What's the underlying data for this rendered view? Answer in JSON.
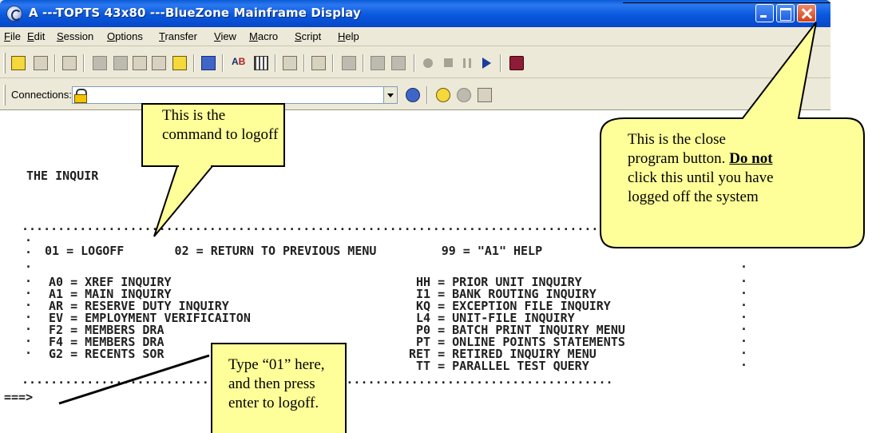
{
  "window": {
    "title": "A ---TOPTS 43x80 ---BlueZone Mainframe Display"
  },
  "menu": {
    "items": [
      {
        "key": "F",
        "rest": "ile"
      },
      {
        "key": "E",
        "rest": "dit"
      },
      {
        "key": "S",
        "rest": "ession"
      },
      {
        "key": "O",
        "rest": "ptions"
      },
      {
        "key": "T",
        "rest": "ransfer"
      },
      {
        "key": "V",
        "rest": "iew"
      },
      {
        "key": "M",
        "rest": "acro"
      },
      {
        "key": "S",
        "rest": "cript"
      },
      {
        "key": "H",
        "rest": "elp"
      }
    ]
  },
  "toolbar2": {
    "connections_label": "Connections:"
  },
  "terminal": {
    "screen_title": "THE INQUIR",
    "dot_line": "..................................................................................",
    "top_options": "01 = LOGOFF       02 = RETURN TO PREVIOUS MENU         99 = \"A1\" HELP",
    "left_options": [
      "A0 = XREF INQUIRY",
      "A1 = MAIN INQUIRY",
      "AR = RESERVE DUTY INQUIRY",
      "EV = EMPLOYMENT VERIFICAITON",
      "F2 = MEMBERS DRA",
      "F4 = MEMBERS DRA",
      "G2 = RECENTS SOR"
    ],
    "right_options": [
      "HH = PRIOR UNIT INQUIRY",
      "I1 = BANK ROUTING INQUIRY",
      "KQ = EXCEPTION FILE INQUIRY",
      "L4 = UNIT-FILE INQUIRY",
      "P0 = BATCH PRINT INQUIRY MENU",
      "PT = ONLINE POINTS STATEMENTS",
      "RET = RETIRED INQUIRY MENU",
      "TT = PARALLEL TEST QUERY"
    ],
    "prompt": "===>"
  },
  "callouts": {
    "logoff": "This is the command to logoff",
    "close_line1": "This is the close",
    "close_line2_pre": "program button. ",
    "close_line2_bold": "Do not",
    "close_line3": "click this until you have",
    "close_line4": "logged off the system",
    "enter": "Type “01” here, and then press enter to logoff."
  },
  "colors": {
    "titlebar": "#0a58dd",
    "callout_fill": "#ffff99",
    "close_button": "#d1421a"
  }
}
